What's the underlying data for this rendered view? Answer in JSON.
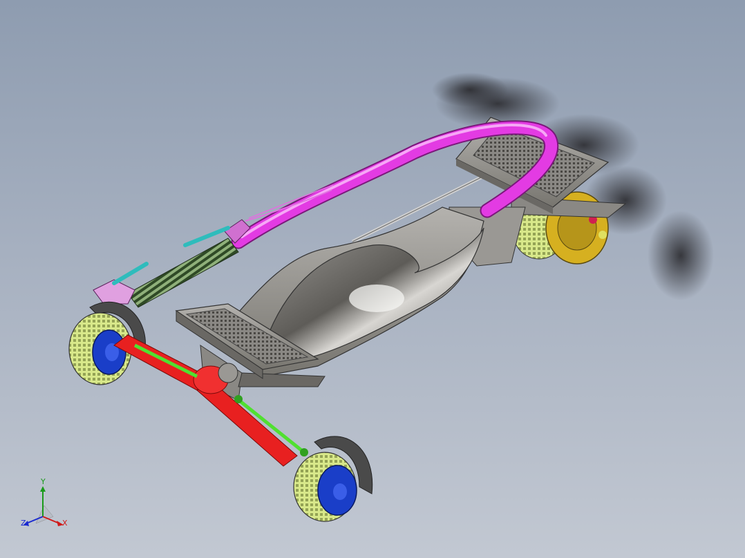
{
  "viewport": {
    "background_top": "#8e9cb0",
    "background_bottom": "#c2c8d2"
  },
  "model": {
    "parts": [
      {
        "name": "shadow",
        "color": "#3c3c40"
      },
      {
        "name": "deck",
        "color": "#9a9894"
      },
      {
        "name": "seat",
        "color": "#6e6c68"
      },
      {
        "name": "handlebar",
        "color": "#e33be3"
      },
      {
        "name": "steering-column-spring",
        "color": "#4a6a3a"
      },
      {
        "name": "brake-lever",
        "color": "#2fbcbc"
      },
      {
        "name": "suspension-arm",
        "color": "#e82020"
      },
      {
        "name": "tie-rod",
        "color": "#50e030"
      },
      {
        "name": "tire",
        "color": "#cfe07a"
      },
      {
        "name": "wheel-hub",
        "color": "#1a3ec8"
      },
      {
        "name": "fender",
        "color": "#3a3a3a"
      },
      {
        "name": "brake-disc",
        "color": "#d6b020"
      }
    ]
  },
  "triad": {
    "y_label": "Y",
    "z_label": "Z",
    "x_label": "X",
    "colors": {
      "x": "#d01a1a",
      "y": "#1a9a1a",
      "z": "#1a2ad0"
    }
  }
}
